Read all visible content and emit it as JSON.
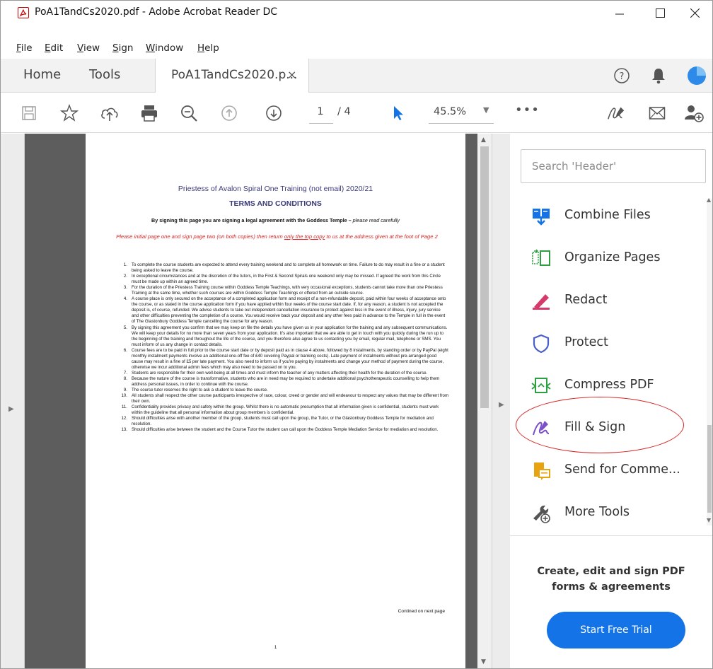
{
  "window": {
    "title": "PoA1TandCs2020.pdf - Adobe Acrobat Reader DC",
    "app_icon": "acrobat-pdf-icon"
  },
  "menu": [
    "File",
    "Edit",
    "View",
    "Sign",
    "Window",
    "Help"
  ],
  "tabs": {
    "home": "Home",
    "tools": "Tools",
    "document": "PoA1TandCs2020.p...",
    "close": "×"
  },
  "toolbar": {
    "page_current": "1",
    "page_total": "/ 4",
    "zoom": "45.5%",
    "more": "•••",
    "icons": [
      "save-icon",
      "bookmark-star-icon",
      "upload-cloud-icon",
      "print-icon",
      "zoom-out-icon",
      "previous-page-icon",
      "next-page-icon",
      "select-pointer-icon",
      "sign-icon",
      "email-icon",
      "add-user-icon"
    ]
  },
  "document": {
    "title": "Priestess of Avalon Spiral One Training (not email) 2020/21",
    "heading": "TERMS AND CONDITIONS",
    "legal_bold": "By signing this page you are signing a legal agreement with the Goddess Temple – ",
    "legal_italic": "please read carefully",
    "instruction_pre": "Please initial page one and sign page two (on both copies) then return ",
    "instruction_underlined": "only the top copy",
    "instruction_post": " to us at the address given at the foot of Page 2",
    "items": [
      {
        "n": "1.",
        "text": "To complete the course students are expected to attend every training weekend and to complete all homework on time. Failure to do may result in a fine or a student being asked to leave the course."
      },
      {
        "n": "2.",
        "text": "In exceptional circumstances and at the discretion of the tutors, in the First & Second Spirals one weekend only may be missed. If agreed the work from this Circle must be made up within an agreed time."
      },
      {
        "n": "3.",
        "text": "For the duration of the Priestess Training course within Goddess Temple Teachings, with very occasional exceptions, students cannot take more than one Priestess Training at the same time, whether such courses are within Goddess Temple Teachings or offered from an outside source."
      },
      {
        "n": "4.",
        "text": "A course place is only secured on the acceptance of a completed application form and receipt of a non-refundable deposit, paid within four weeks of acceptance onto the course, or as stated in the course application form if you have applied within four weeks of the course start date. If, for any reason, a student is not accepted the deposit is, of course, refunded. We advise students to take out independent cancellation insurance to protect against loss in the event of illness, injury, jury service and other difficulties preventing the completion of a course. You would receive back your deposit and any other fees paid in advance to the Temple in full in the event of The Glastonbury Goddess Temple cancelling the course for any reason."
      },
      {
        "n": "5.",
        "text": "By signing this agreement you confirm that we may keep on file the details you have given us in your application for the training and any subsequent communications. We will keep your details for no more than seven years from your application. It's also important that we are able to get in touch with you quickly during the run up to the beginning of the training and throughout the life of the course, and you therefore also agree to us contacting you by email, regular mail, telephone or SMS. You must inform of us any change in contact details."
      },
      {
        "n": "6.",
        "text": "Course fees are to be paid in full prior to the course start date or by deposit paid as in clause 4 above, followed by 8 instalments, by standing order or by PayPal (eight monthly instalment payments involve an additional one-off fee of £40 covering Paypal or banking costs). Late payment of instalments without pre-arranged good cause may result in a fine of £5 per late payment. You also need to inform us if you're paying by instalments and change your method of payment during the course, otherwise we incur additional admin fees which may also need to be passed on to you."
      },
      {
        "n": "7.",
        "text": "Students are responsible for their own well-being at all times and must inform the teacher of any matters affecting their health for the duration of the course."
      },
      {
        "n": "8.",
        "text": "Because the nature of the course is transformative, students who are in need may be required to undertake additional psychotherapeutic counselling to help them address personal issues, in order to continue with the course."
      },
      {
        "n": "9.",
        "text": "The course tutor reserves the right to ask a student to leave the course."
      },
      {
        "n": "10.",
        "text": "All students shall respect the other course participants irrespective of race, colour, creed or gender and will endeavour to respect any values that may be different from their own."
      },
      {
        "n": "11.",
        "text": "Confidentiality provides privacy and safety within the group. Whilst there is no automatic presumption that all information given is confidential, students must work within the guideline that all personal information about group members is confidential."
      },
      {
        "n": "12.",
        "text": "Should difficulties arise with another member of the group, students must call upon the group, the Tutor, or the Glastonbury Goddess Temple for mediation and resolution."
      },
      {
        "n": "13.",
        "text": "Should difficulties arise between the student and the Course Tutor the student can call upon the Goddess Temple Mediation Service for mediation and resolution."
      }
    ],
    "continued": "Contined on next page",
    "page_number": "1"
  },
  "tool_pane": {
    "search_placeholder": "Search 'Header'",
    "tools": [
      {
        "label": "Combine Files",
        "icon": "combine-files-icon",
        "color": "#1473e6"
      },
      {
        "label": "Organize Pages",
        "icon": "organize-pages-icon",
        "color": "#2ea043"
      },
      {
        "label": "Redact",
        "icon": "redact-icon",
        "color": "#d43b6b"
      },
      {
        "label": "Protect",
        "icon": "protect-shield-icon",
        "color": "#4b5fc9"
      },
      {
        "label": "Compress PDF",
        "icon": "compress-pdf-icon",
        "color": "#2ea043"
      },
      {
        "label": "Fill & Sign",
        "icon": "fill-sign-icon",
        "color": "#7b4fc9"
      },
      {
        "label": "Send for Comme...",
        "icon": "send-for-comment-icon",
        "color": "#e8a310"
      },
      {
        "label": "More Tools",
        "icon": "more-tools-icon",
        "color": "#555555"
      }
    ],
    "promo": "Create, edit and sign PDF forms & agreements",
    "trial_button": "Start Free Trial"
  },
  "colors": {
    "accent": "#1473e6",
    "annotation_circle": "#d92020",
    "doc_background": "#5d5d5d"
  }
}
